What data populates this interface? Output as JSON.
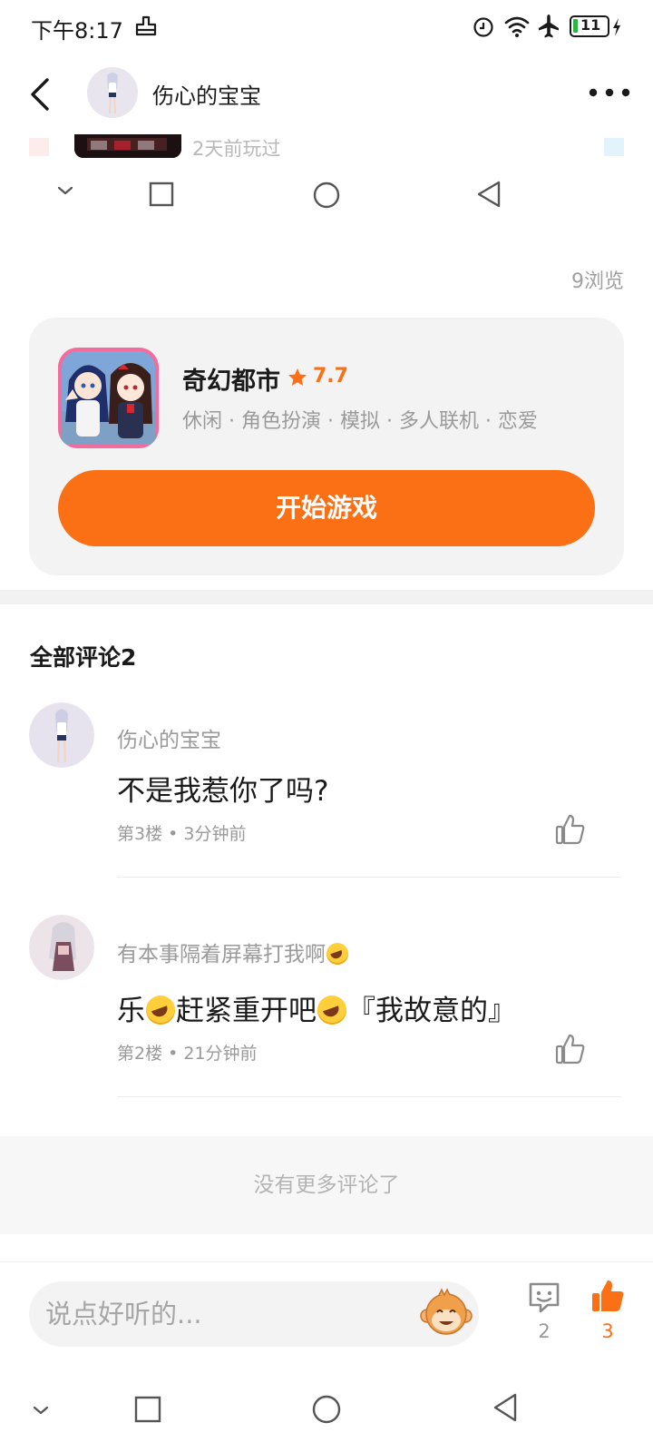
{
  "status_bar": {
    "time": "下午8:17",
    "battery": "11"
  },
  "header": {
    "user_name": "伤心的宝宝"
  },
  "top_strip": {
    "text": "2天前玩过"
  },
  "post": {
    "views": "9浏览"
  },
  "game": {
    "name": "奇幻都市",
    "rating": "7.7",
    "tags": "休闲 · 角色扮演 · 模拟 · 多人联机 · 恋爱",
    "play_label": "开始游戏"
  },
  "comments": {
    "title": "全部评论2",
    "items": [
      {
        "name": "伤心的宝宝",
        "text": "不是我惹你了吗?",
        "meta": "第3楼 • 3分钟前"
      },
      {
        "name": "有本事隔着屏幕打我啊",
        "text_a": "乐",
        "text_b": "赶紧重开吧",
        "text_c": "『我故意的』",
        "meta": "第2楼 • 21分钟前"
      }
    ],
    "no_more": "没有更多评论了"
  },
  "bottom": {
    "input_placeholder": "说点好听的...",
    "comment_count": "2",
    "like_count": "3"
  },
  "colors": {
    "accent": "#fb6f15",
    "card_bg": "#f3f3f3"
  },
  "icons": [
    "back-icon",
    "more-icon",
    "star-icon",
    "like-icon",
    "comment-icon",
    "thumb-up-filled-icon",
    "emoji-laugh-icon",
    "monkey-face-icon",
    "square-icon",
    "circle-icon",
    "triangle-back-icon",
    "chevron-down-icon"
  ]
}
